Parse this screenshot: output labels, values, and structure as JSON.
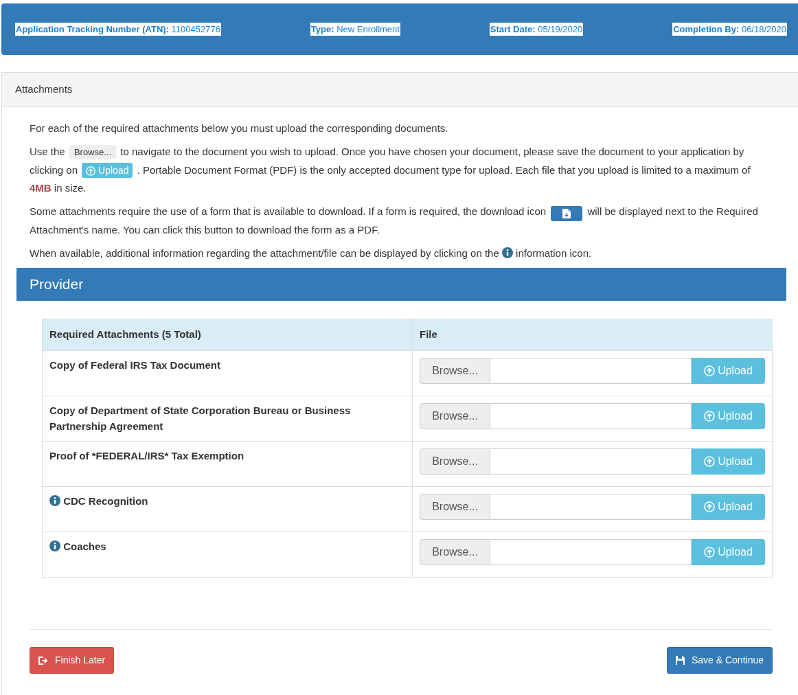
{
  "header": [
    {
      "label": "Application Tracking Number (ATN):",
      "value": "1100452776"
    },
    {
      "label": "Type:",
      "value": "New Enrollment"
    },
    {
      "label": "Start Date:",
      "value": "05/19/2020"
    },
    {
      "label": "Completion By:",
      "value": "06/18/2020"
    }
  ],
  "panel_title": "Attachments",
  "paragraphs": [
    [
      {
        "kind": "text",
        "text": "For each of the required attachments below you must upload the corresponding documents."
      }
    ],
    [
      {
        "kind": "text",
        "text": "Use the"
      },
      {
        "kind": "browse",
        "label": "Browse..."
      },
      {
        "kind": "text",
        "text": "to navigate to the document you wish to upload. Once you have chosen your document, please save the document to your application by clicking on"
      },
      {
        "kind": "upload",
        "label": "Upload"
      },
      {
        "kind": "text",
        "text": ". Portable Document Format (PDF) is the only accepted document type for upload. Each file that you upload is limited to a maximum of **4MB** in size."
      }
    ],
    [
      {
        "kind": "text",
        "text": "Some attachments require the use of a form that is available to download. If a form is required, the download icon"
      },
      {
        "kind": "download"
      },
      {
        "kind": "text",
        "text": "will be displayed next to the Required Attachment's name. You can click this button to download the form as a PDF."
      }
    ],
    [
      {
        "kind": "text",
        "text": "When available, additional information regarding the attachment/file can be displayed by clicking on the"
      },
      {
        "kind": "info"
      },
      {
        "kind": "text",
        "text": "information icon."
      }
    ]
  ],
  "section_title": "Provider",
  "table": {
    "columns": [
      "Required Attachments (5 Total)",
      "File"
    ],
    "rows": [
      {
        "name": "Copy of Federal IRS Tax Document",
        "info": false,
        "browse": "Browse...",
        "upload": "Upload"
      },
      {
        "name": "Copy of Department of State Corporation Bureau or Business Partnership Agreement",
        "info": false,
        "browse": "Browse...",
        "upload": "Upload"
      },
      {
        "name": "Proof of *FEDERAL/IRS* Tax Exemption",
        "info": false,
        "browse": "Browse...",
        "upload": "Upload"
      },
      {
        "name": "CDC Recognition",
        "info": true,
        "browse": "Browse...",
        "upload": "Upload"
      },
      {
        "name": "Coaches",
        "info": true,
        "browse": "Browse...",
        "upload": "Upload"
      }
    ]
  },
  "buttons": [
    {
      "kind": "finish",
      "label": "Finish Later"
    },
    {
      "kind": "save",
      "label": "Save & Continue"
    }
  ]
}
